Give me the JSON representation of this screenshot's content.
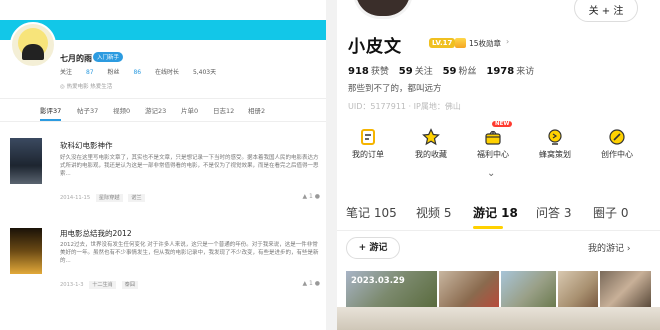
{
  "left": {
    "username": "七月的雨",
    "badge": "入门新手",
    "stats": {
      "follow_label": "关注",
      "follow_value": "87",
      "fans_label": "粉丝",
      "fans_value": "86",
      "time_label": "在线时长",
      "time_value": "5,403天"
    },
    "signature": "热爱电影 热爱生活",
    "tabs": [
      "影评37",
      "帖子37",
      "视频0",
      "游记23",
      "片单0",
      "日志12",
      "相册2"
    ],
    "reviews": [
      {
        "title": "软科幻电影神作",
        "text": "好久没在这里写电影文章了，其实也不是文章，只是想记录一下当时的感受。据本着我国人民的电影表达方式所讲的电影观，我还是认为这是一部非常值得看的电影，不是仅为了视觉效果，而是在看完之后值得一思索...",
        "date": "2014-11-15",
        "tags": [
          "星际穿越",
          "诺兰"
        ],
        "icon_counts": [
          "1",
          ""
        ]
      },
      {
        "title": "用电影总结我的2012",
        "text": "2012过去，世界没有发生任何变化 对于许多人来说，这只是一个普通的年份。对于我来说，这是一件非常美好的一年。虽然也有不少事情发生，但从我的电影记录中，我发现了不少改变，有些是进步的，有些是新的...",
        "date": "2013-1-3",
        "tags": [
          "十二生肖",
          "泰囧"
        ],
        "icon_counts": [
          "1",
          ""
        ]
      }
    ]
  },
  "right": {
    "follow_btn": "关 + 注",
    "username": "小皮文",
    "level": "LV.17",
    "medals": "15枚勋章",
    "stats": [
      {
        "num": "918",
        "label": "获赞"
      },
      {
        "num": "59",
        "label": "关注"
      },
      {
        "num": "59",
        "label": "粉丝"
      },
      {
        "num": "1978",
        "label": "来访"
      }
    ],
    "bio": "那些到不了的，都叫远方",
    "uid": "UID：5177911 · IP属地：佛山",
    "actions": [
      {
        "label": "我的订单",
        "icon": "order-icon"
      },
      {
        "label": "我的收藏",
        "icon": "star-icon"
      },
      {
        "label": "福利中心",
        "icon": "gift-icon"
      },
      {
        "label": "蜂窝策划",
        "icon": "bulb-icon"
      },
      {
        "label": "创作中心",
        "icon": "pen-icon"
      }
    ],
    "new_badge": "NEW",
    "tabs": [
      {
        "label": "笔记 105"
      },
      {
        "label": "视频 5"
      },
      {
        "label": "游记 18"
      },
      {
        "label": "问答 3"
      },
      {
        "label": "圈子 0"
      }
    ],
    "add_btn": "+ 游记",
    "my_trips": "我的游记 ›",
    "photo_date": "2023.03.29",
    "colors": {
      "accent": "#ffd100",
      "icon": "#f5b400"
    }
  }
}
